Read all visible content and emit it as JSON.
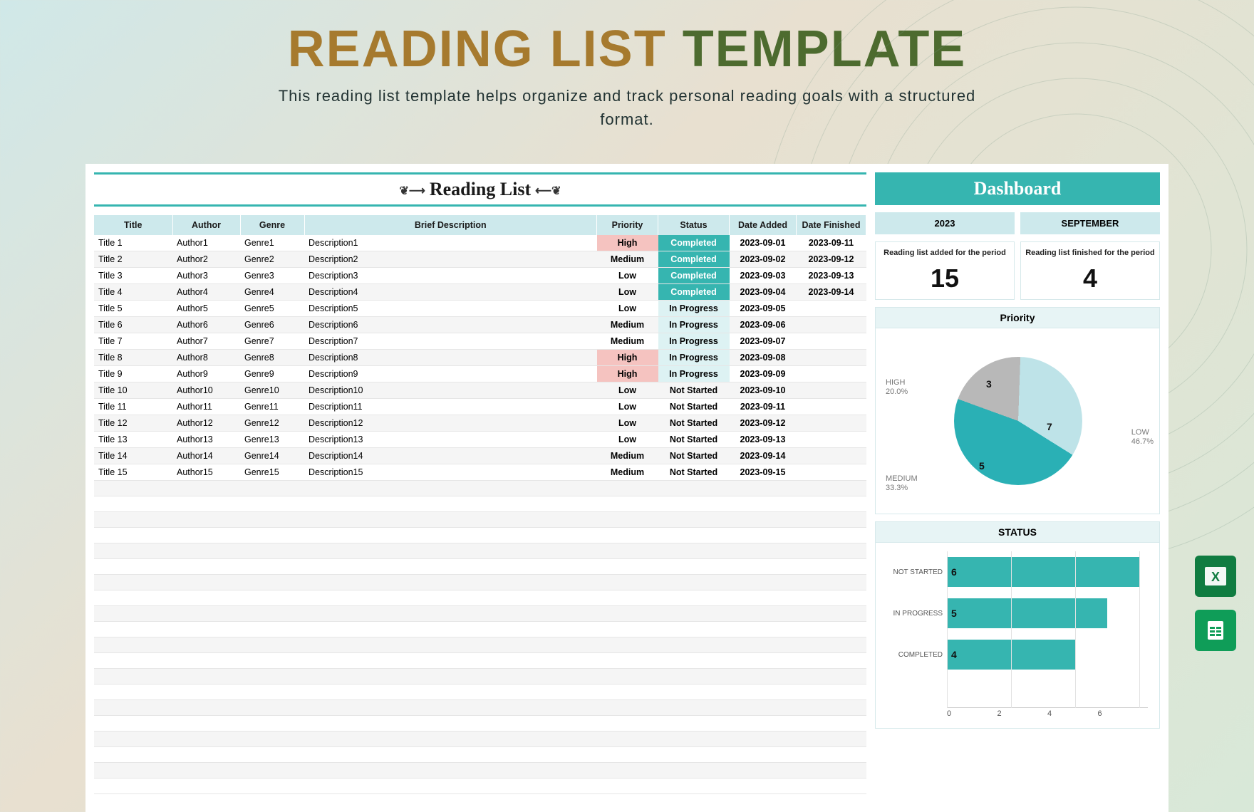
{
  "hero": {
    "title1": "READING LIST ",
    "title2": "TEMPLATE",
    "subtitle": "This reading list template helps organize and track personal reading goals with a structured format."
  },
  "list_title": "Reading List",
  "columns": [
    "Title",
    "Author",
    "Genre",
    "Brief Description",
    "Priority",
    "Status",
    "Date Added",
    "Date Finished"
  ],
  "rows": [
    {
      "title": "Title 1",
      "author": "Author1",
      "genre": "Genre1",
      "desc": "Description1",
      "priority": "High",
      "status": "Completed",
      "added": "2023-09-01",
      "finished": "2023-09-11"
    },
    {
      "title": "Title 2",
      "author": "Author2",
      "genre": "Genre2",
      "desc": "Description2",
      "priority": "Medium",
      "status": "Completed",
      "added": "2023-09-02",
      "finished": "2023-09-12"
    },
    {
      "title": "Title 3",
      "author": "Author3",
      "genre": "Genre3",
      "desc": "Description3",
      "priority": "Low",
      "status": "Completed",
      "added": "2023-09-03",
      "finished": "2023-09-13"
    },
    {
      "title": "Title 4",
      "author": "Author4",
      "genre": "Genre4",
      "desc": "Description4",
      "priority": "Low",
      "status": "Completed",
      "added": "2023-09-04",
      "finished": "2023-09-14"
    },
    {
      "title": "Title 5",
      "author": "Author5",
      "genre": "Genre5",
      "desc": "Description5",
      "priority": "Low",
      "status": "In Progress",
      "added": "2023-09-05",
      "finished": ""
    },
    {
      "title": "Title 6",
      "author": "Author6",
      "genre": "Genre6",
      "desc": "Description6",
      "priority": "Medium",
      "status": "In Progress",
      "added": "2023-09-06",
      "finished": ""
    },
    {
      "title": "Title 7",
      "author": "Author7",
      "genre": "Genre7",
      "desc": "Description7",
      "priority": "Medium",
      "status": "In Progress",
      "added": "2023-09-07",
      "finished": ""
    },
    {
      "title": "Title 8",
      "author": "Author8",
      "genre": "Genre8",
      "desc": "Description8",
      "priority": "High",
      "status": "In Progress",
      "added": "2023-09-08",
      "finished": ""
    },
    {
      "title": "Title 9",
      "author": "Author9",
      "genre": "Genre9",
      "desc": "Description9",
      "priority": "High",
      "status": "In Progress",
      "added": "2023-09-09",
      "finished": ""
    },
    {
      "title": "Title 10",
      "author": "Author10",
      "genre": "Genre10",
      "desc": "Description10",
      "priority": "Low",
      "status": "Not Started",
      "added": "2023-09-10",
      "finished": ""
    },
    {
      "title": "Title 11",
      "author": "Author11",
      "genre": "Genre11",
      "desc": "Description11",
      "priority": "Low",
      "status": "Not Started",
      "added": "2023-09-11",
      "finished": ""
    },
    {
      "title": "Title 12",
      "author": "Author12",
      "genre": "Genre12",
      "desc": "Description12",
      "priority": "Low",
      "status": "Not Started",
      "added": "2023-09-12",
      "finished": ""
    },
    {
      "title": "Title 13",
      "author": "Author13",
      "genre": "Genre13",
      "desc": "Description13",
      "priority": "Low",
      "status": "Not Started",
      "added": "2023-09-13",
      "finished": ""
    },
    {
      "title": "Title 14",
      "author": "Author14",
      "genre": "Genre14",
      "desc": "Description14",
      "priority": "Medium",
      "status": "Not Started",
      "added": "2023-09-14",
      "finished": ""
    },
    {
      "title": "Title 15",
      "author": "Author15",
      "genre": "Genre15",
      "desc": "Description15",
      "priority": "Medium",
      "status": "Not Started",
      "added": "2023-09-15",
      "finished": ""
    }
  ],
  "empty_rows": 20,
  "dashboard": {
    "title": "Dashboard",
    "year": "2023",
    "month": "SEPTEMBER",
    "added_label": "Reading list added for the period",
    "added_value": "15",
    "finished_label": "Reading list finished for the period",
    "finished_value": "4",
    "priority_title": "Priority",
    "status_title": "STATUS"
  },
  "chart_data": [
    {
      "type": "pie",
      "title": "Priority",
      "series": [
        {
          "name": "Priority",
          "values": [
            7,
            5,
            3
          ]
        }
      ],
      "categories": [
        "LOW",
        "MEDIUM",
        "HIGH"
      ],
      "percentages": [
        "46.7%",
        "33.3%",
        "20.0%"
      ],
      "colors": [
        "#2AB0B5",
        "#BEE3E8",
        "#B8B8B8"
      ]
    },
    {
      "type": "bar",
      "title": "STATUS",
      "categories": [
        "NOT STARTED",
        "IN PROGRESS",
        "COMPLETED"
      ],
      "values": [
        6,
        5,
        4
      ],
      "xlim": [
        0,
        6
      ],
      "ticks": [
        0,
        2,
        4,
        6
      ],
      "color": "#36B5B0"
    }
  ],
  "app_icons": [
    "excel-icon",
    "google-sheets-icon"
  ]
}
